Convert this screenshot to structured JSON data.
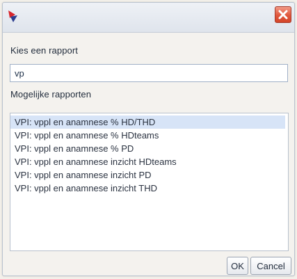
{
  "dialog": {
    "choose_label": "Kies een rapport",
    "search_value": "vp",
    "possible_label": "Mogelijke rapporten",
    "reports": [
      "VPI: vppl en anamnese % HD/THD",
      "VPI: vppl en anamnese % HDteams",
      "VPI: vppl en anamnese % PD",
      "VPI: vppl en anamnese inzicht HDteams",
      "VPI: vppl en anamnese inzicht PD",
      "VPI: vppl en anamnese inzicht THD"
    ],
    "selected_index": 0,
    "ok_label": "OK",
    "cancel_label": "Cancel"
  },
  "icons": {
    "app_logo": "app-logo-icon",
    "close": "close-icon"
  },
  "colors": {
    "selection": "#d7e4f7",
    "close_button": "#e0573c",
    "logo_red": "#d9262c",
    "logo_blue": "#2c3e8f"
  }
}
